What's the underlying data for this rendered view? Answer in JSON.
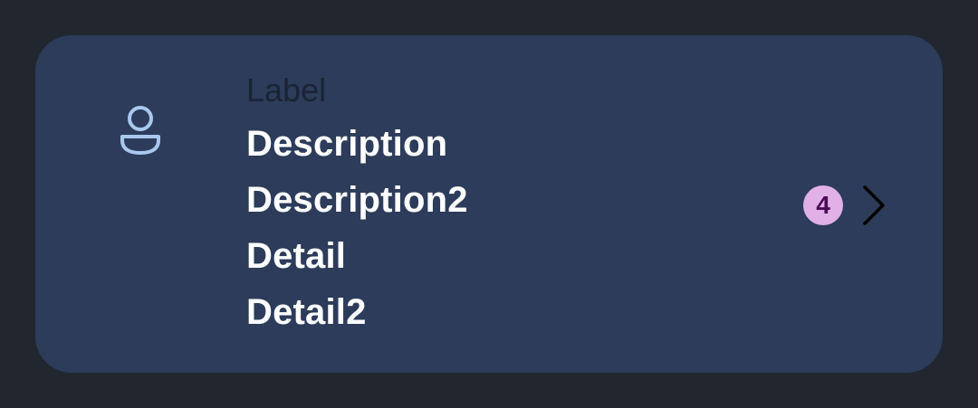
{
  "list_item": {
    "icon": "person-icon",
    "label": "Label",
    "description": "Description",
    "description2": "Description2",
    "detail": "Detail",
    "detail2": "Detail2",
    "badge_count": "4",
    "trailing_icon": "chevron-right-icon"
  },
  "colors": {
    "background": "#21262f",
    "card": "#2c3c5a",
    "icon": "#a9c8ee",
    "badge_bg": "#e0b0e6",
    "badge_text": "#4a0a56"
  }
}
